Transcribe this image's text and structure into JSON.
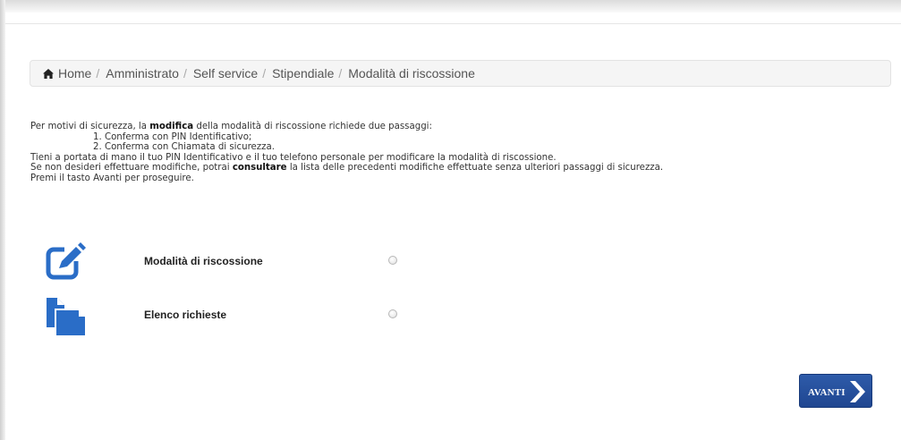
{
  "breadcrumb": {
    "items": [
      "Home",
      "Amministrato",
      "Self service",
      "Stipendiale",
      "Modalità di riscossione"
    ],
    "separator": "/"
  },
  "intro": {
    "line1_pre": "Per motivi di sicurezza, la ",
    "line1_bold": "modifica",
    "line1_post": " della modalità di riscossione richiede due passaggi:",
    "step1": "1. Conferma con PIN Identificativo;",
    "step2": "2. Conferma con Chiamata di sicurezza.",
    "line4": "Tieni a portata di mano il tuo PIN Identificativo e il tuo telefono personale per modificare la modalità di riscossione.",
    "line5_pre": "Se non desideri effettuare modifiche, potrai ",
    "line5_bold": "consultare",
    "line5_post": " la lista delle precedenti modifiche effettuate senza ulteriori passaggi di sicurezza.",
    "line6": "Premi il tasto Avanti per proseguire."
  },
  "options": [
    {
      "label": "Modalità di riscossione",
      "icon": "edit-icon",
      "selected": false
    },
    {
      "label": "Elenco richieste",
      "icon": "documents-icon",
      "selected": false
    }
  ],
  "button": {
    "label": "AVANTI",
    "icon": "chevron-right-icon"
  },
  "colors": {
    "primary": "#1f4691",
    "icon_blue": "#2a6dc7",
    "breadcrumb_bg": "#f5f5f5"
  }
}
